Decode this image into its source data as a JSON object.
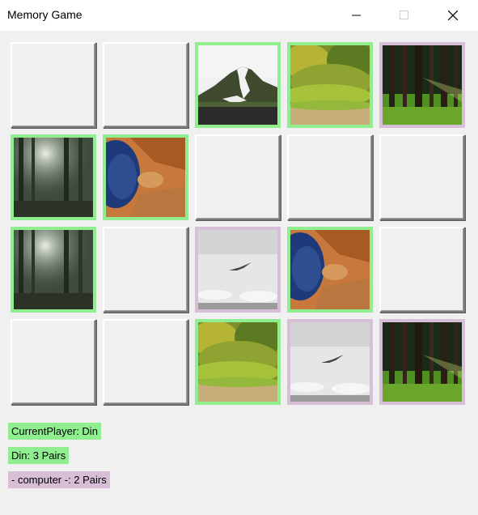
{
  "window": {
    "title": "Memory Game"
  },
  "colors": {
    "player_highlight": "#90ee90",
    "computer_highlight": "#d8bfd8"
  },
  "board": {
    "rows": 4,
    "cols": 5,
    "cards": [
      {
        "image": null,
        "owner": null
      },
      {
        "image": null,
        "owner": null
      },
      {
        "image": "mountain",
        "owner": "player"
      },
      {
        "image": "meadow-hill",
        "owner": "player"
      },
      {
        "image": "sunlit-forest",
        "owner": "computer"
      },
      {
        "image": "misty-forest",
        "owner": "player"
      },
      {
        "image": "aerial-landscape",
        "owner": "player"
      },
      {
        "image": null,
        "owner": null
      },
      {
        "image": null,
        "owner": null
      },
      {
        "image": null,
        "owner": null
      },
      {
        "image": "misty-forest",
        "owner": "player"
      },
      {
        "image": null,
        "owner": null
      },
      {
        "image": "bird-in-sky",
        "owner": "computer"
      },
      {
        "image": "aerial-landscape",
        "owner": "player"
      },
      {
        "image": null,
        "owner": null
      },
      {
        "image": null,
        "owner": null
      },
      {
        "image": null,
        "owner": null
      },
      {
        "image": "meadow-hill",
        "owner": "player"
      },
      {
        "image": "bird-in-sky",
        "owner": "computer"
      },
      {
        "image": "sunlit-forest",
        "owner": "computer"
      }
    ]
  },
  "status": {
    "current_player": "CurrentPlayer: Din",
    "player_score": "Din: 3 Pairs",
    "computer_score": "- computer -: 2 Pairs"
  }
}
